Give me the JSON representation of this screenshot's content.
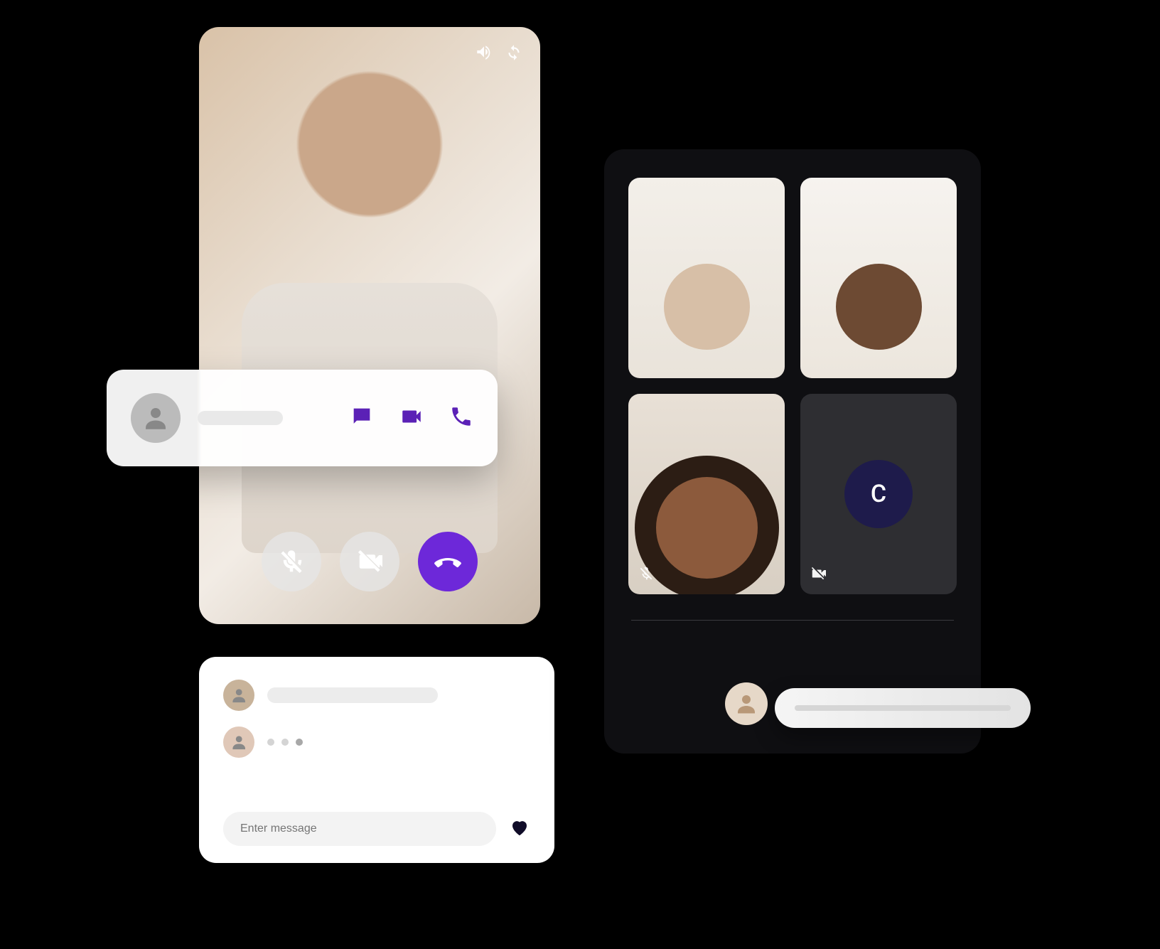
{
  "call": {
    "top_icons": [
      "speaker-icon",
      "switch-camera-icon"
    ],
    "controls": {
      "mute_mic": "mic-off-icon",
      "mute_cam": "camera-off-icon",
      "end": "hangup-icon"
    }
  },
  "contact_pill": {
    "actions": {
      "chat": "chat-icon",
      "video": "video-icon",
      "call": "phone-icon"
    }
  },
  "chat": {
    "input_placeholder": "Enter message",
    "send_icon": "heart-icon"
  },
  "group": {
    "tiles": [
      {
        "id": "p1",
        "muted": false,
        "cam_off": false
      },
      {
        "id": "p2",
        "muted": false,
        "cam_off": false
      },
      {
        "id": "p3",
        "muted": true,
        "cam_off": false,
        "mute_icon": "volume-off-icon"
      },
      {
        "id": "p4",
        "muted": false,
        "cam_off": true,
        "initial": "C",
        "cam_off_icon": "camera-off-icon"
      }
    ]
  },
  "colors": {
    "accent": "#6d28d9",
    "dark_navy": "#1e1b4b"
  }
}
